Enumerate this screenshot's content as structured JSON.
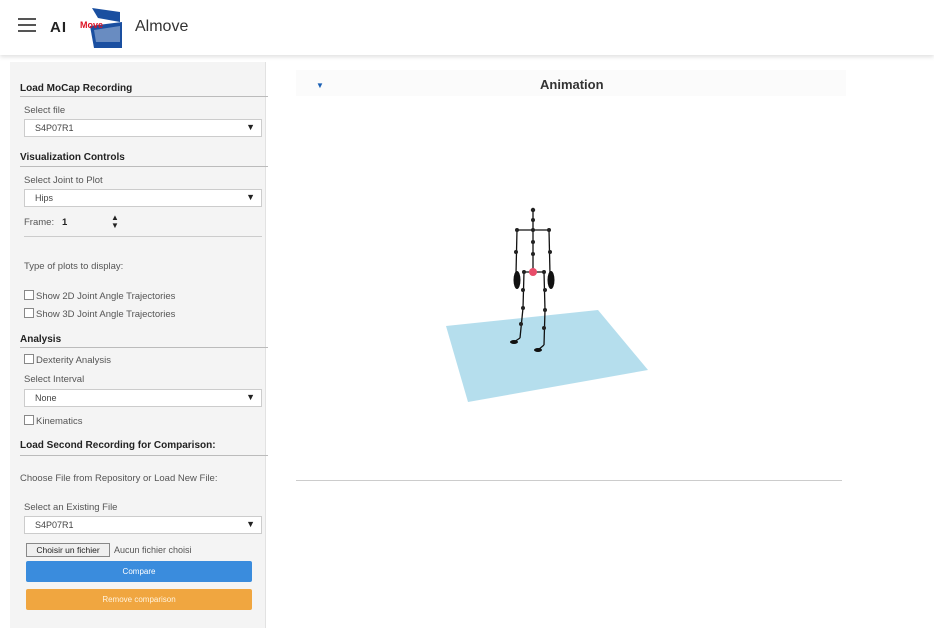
{
  "header": {
    "logo_ai": "AI",
    "logo_move": "Move",
    "app_title": "Almove"
  },
  "sidebar": {
    "load_section_title": "Load MoCap Recording",
    "select_file_label": "Select file",
    "select_file_value": "S4P07R1",
    "vis_section_title": "Visualization Controls",
    "joint_label": "Select Joint to Plot",
    "joint_value": "Hips",
    "frame_label": "Frame:",
    "frame_value": "1",
    "plot_types_label": "Type of plots to display:",
    "show_2d_label": "Show 2D Joint Angle Trajectories",
    "show_3d_label": "Show 3D Joint Angle Trajectories",
    "analysis_title": "Analysis",
    "dexterity_label": "Dexterity Analysis",
    "interval_label": "Select Interval",
    "interval_value": "None",
    "kinematics_label": "Kinematics",
    "second_title": "Load Second Recording for Comparison:",
    "choose_text": "Choose File from Repository or Load New File:",
    "existing_label": "Select an Existing File",
    "existing_value": "S4P07R1",
    "file_button": "Choisir un fichier",
    "no_file_text": "Aucun fichier choisi",
    "compare_button": "Compare",
    "remove_button": "Remove comparison"
  },
  "main": {
    "panel_title": "Animation",
    "toggle_glyph": "▼"
  },
  "colors": {
    "accent_blue": "#3a8cdd",
    "accent_orange": "#f0a640",
    "floor": "#a8d8ea",
    "joint_highlight": "#e84d6a"
  }
}
